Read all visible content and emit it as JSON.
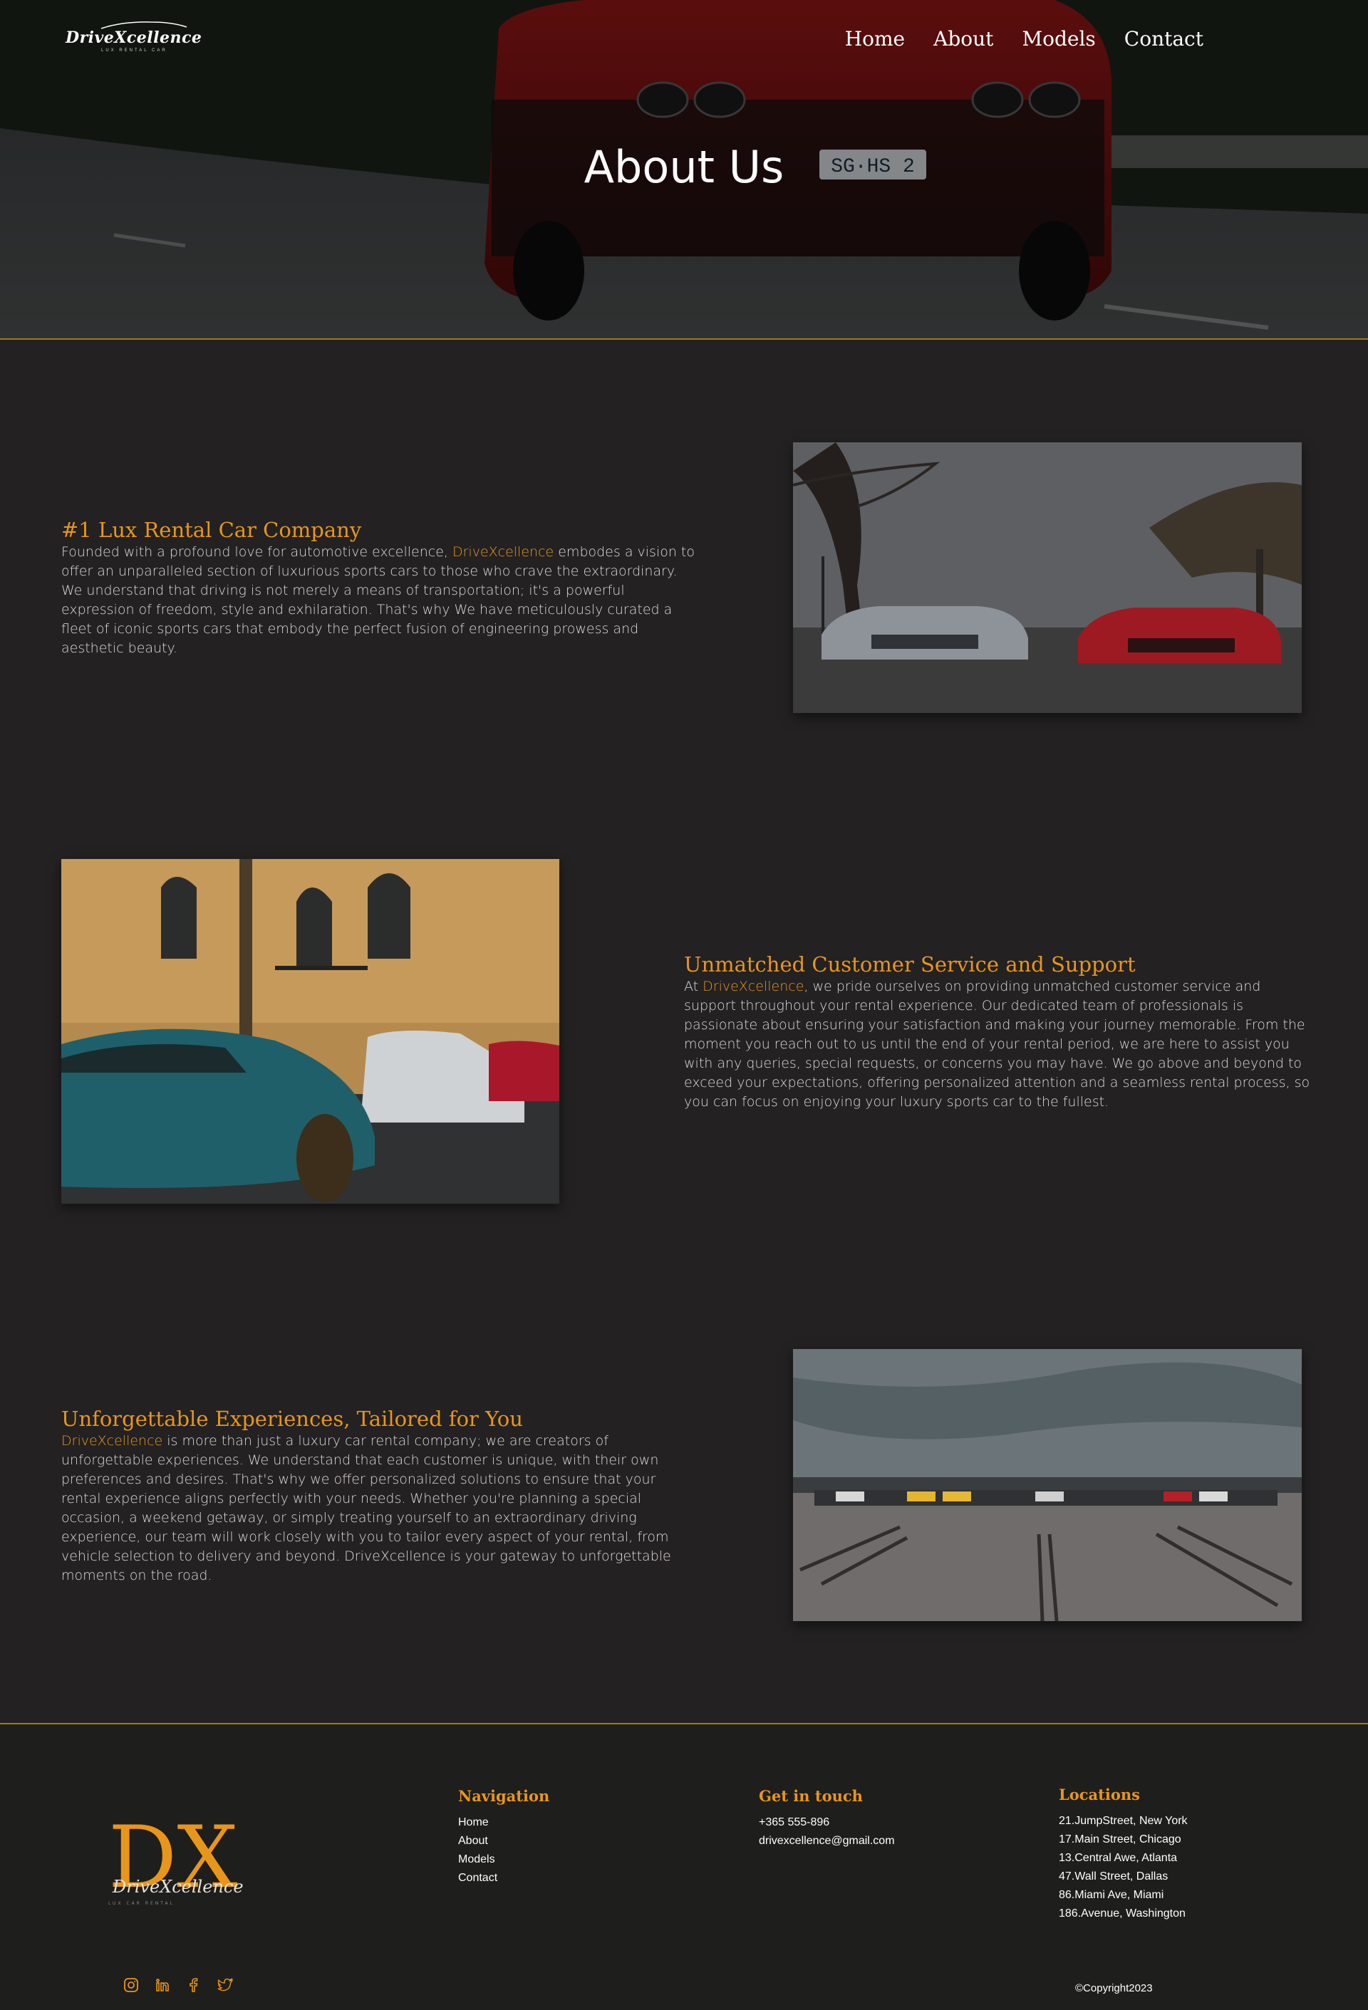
{
  "brand": {
    "name": "DriveXcellence",
    "tagline": "LUX RENTAL CAR"
  },
  "nav": {
    "home": "Home",
    "about": "About",
    "models": "Models",
    "contact": "Contact"
  },
  "hero": {
    "title": "About Us"
  },
  "sections": [
    {
      "heading": "#1 Lux Rental Car Company",
      "pre": "Founded with a profound love for automotive excellence, ",
      "brand": "DriveXcellence",
      "post": " embodes a vision to offer an unparalleled section of luxurious sports cars to those who crave the extraordinary. We understand that driving is not merely a means of transportation; it's a powerful expression of freedom, style and exhilaration. That's why We have meticulously curated a fleet of iconic sports cars that embody the perfect fusion of engineering prowess and aesthetic beauty."
    },
    {
      "heading": "Unmatched Customer Service and Support",
      "pre": "At ",
      "brand": "DriveXcellence",
      "post": ", we pride ourselves on providing unmatched customer service and support throughout your rental experience. Our dedicated team of professionals is passionate about ensuring your satisfaction and making your journey memorable. From the moment you reach out to us until the end of your rental period, we are here to assist you with any queries, special requests, or concerns you may have. We go above and beyond to exceed your expectations, offering personalized attention and a seamless rental process, so you can focus on enjoying your luxury sports car to the fullest."
    },
    {
      "heading": "Unforgettable Experiences, Tailored for You",
      "pre": "",
      "brand": "DriveXcellence",
      "post": " is more than just a luxury car rental company; we are creators of unforgettable experiences. We understand that each customer is unique, with their own preferences and desires. That's why we offer personalized solutions to ensure that your rental experience aligns perfectly with your needs. Whether you're planning a special occasion, a weekend getaway, or simply treating yourself to an extraordinary driving experience, our team will work closely with you to tailor every aspect of your rental, from vehicle selection to delivery and beyond. DriveXcellence is your gateway to unforgettable moments on the road."
    }
  ],
  "hero_plate": "SG·HS 2",
  "footer": {
    "logo_mark": "DX",
    "logo_name": "DriveXcellence",
    "logo_sub": "LUX CAR RENTAL",
    "navigation": {
      "title": "Navigation",
      "items": [
        "Home",
        "About",
        "Models",
        "Contact"
      ]
    },
    "contact": {
      "title": "Get in touch",
      "phone": "+365 555-896",
      "email": "drivexcellence@gmail.com"
    },
    "locations": {
      "title": "Locations",
      "items": [
        "21.JumpStreet, New York",
        "17.Main Street, Chicago",
        "13.Central Awe, Atlanta",
        "47.Wall Street, Dallas",
        "86.Miami Ave, Miami",
        "186.Avenue, Washington"
      ]
    },
    "social": [
      "instagram-icon",
      "linkedin-icon",
      "facebook-icon",
      "twitter-icon"
    ],
    "copyright": "©Copyright2023"
  },
  "colors": {
    "accent": "#e8961b",
    "background": "#232122",
    "footer": "#1e1e1d",
    "rule": "#a07b1c"
  }
}
